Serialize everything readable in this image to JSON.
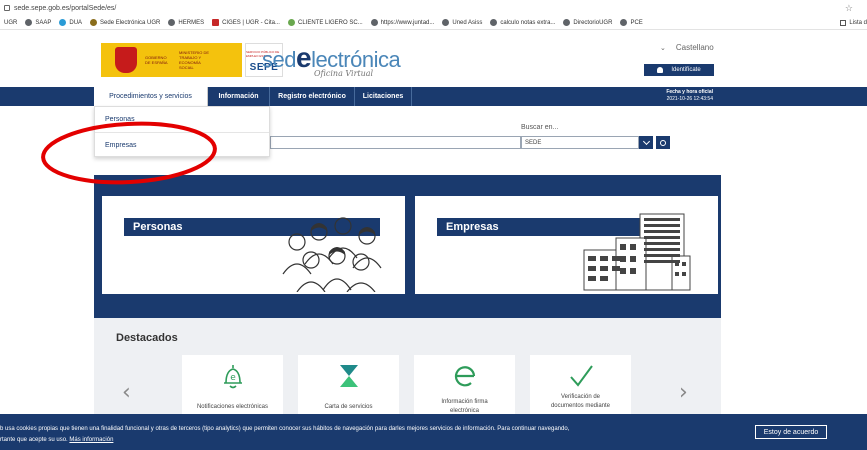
{
  "browser": {
    "url": "sede.sepe.gob.es/portalSede/es/",
    "bookmarks": [
      "UGR",
      "SAAP",
      "DUA",
      "Sede Electrónica UGR",
      "HERMES",
      "CIGES | UGR - Cita...",
      "CLIENTE LIGERO SC...",
      "https://www.juntad...",
      "Uned Asiss",
      "calculo notas extra...",
      "DirectorioUGR",
      "PCE"
    ],
    "reading_list": "Lista d"
  },
  "header": {
    "gov_text_1": "GOBIERNO DE ESPAÑA",
    "gov_text_2": "MINISTERIO DE TRABAJO Y ECONOMÍA SOCIAL",
    "sepe_mini": "SERVICIO PÚBLICO DE EMPLEO ESTATAL",
    "sepe": "SEPE",
    "sede_pre": "sed",
    "sede_e": "e",
    "sede_post": "lectrónica",
    "sede_sub": "Oficina Virtual",
    "language": "Castellano",
    "identify": "Identifícate"
  },
  "nav": {
    "items": [
      "Procedimientos y servicios",
      "Información",
      "Registro electrónico",
      "Licitaciones"
    ],
    "datetime_label": "Fecha y hora oficial",
    "datetime_value": "2021-10-26   12:43:54"
  },
  "dropdown": {
    "items": [
      "Personas",
      "Empresas"
    ]
  },
  "search": {
    "label": "Buscar en...",
    "selected": "SEDE"
  },
  "cards": {
    "personas": "Personas",
    "empresas": "Empresas"
  },
  "destacados": {
    "title": "Destacados",
    "items": [
      {
        "line1": "Notificaciones electrónicas",
        "line2": ""
      },
      {
        "line1": "Carta de servicios",
        "line2": ""
      },
      {
        "line1": "Información firma",
        "line2": "electrónica"
      },
      {
        "line1": "Verificación de",
        "line2": "documentos mediante"
      }
    ],
    "prev": "‹",
    "next": "›"
  },
  "cookie": {
    "line1": "b usa cookies propias que tienen una finalidad funcional y otras de terceros (tipo analytics) que permiten conocer sus hábitos de navegación para darles mejores servicios de información. Para continuar navegando,",
    "line2": "rtante que acepte su uso.",
    "link": "Más información",
    "accept": "Estoy de acuerdo"
  },
  "colors": {
    "navy": "#1a3a6e",
    "annotation": "#e30000"
  }
}
